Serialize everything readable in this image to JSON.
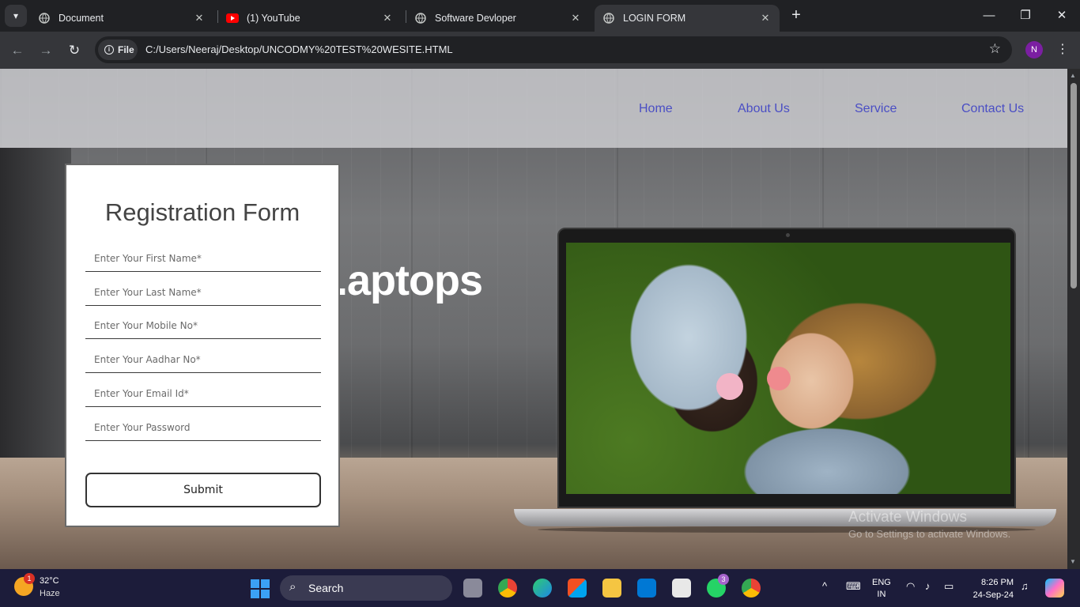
{
  "browser": {
    "tabs": [
      {
        "title": "Document",
        "favicon": "globe-icon",
        "active": false
      },
      {
        "title": "(1) YouTube",
        "favicon": "youtube-icon",
        "active": false
      },
      {
        "title": "Software Devloper",
        "favicon": "globe-icon",
        "active": false
      },
      {
        "title": "LOGIN FORM",
        "favicon": "globe-icon",
        "active": true
      }
    ],
    "address": {
      "chip": "File",
      "url": "C:/Users/Neeraj/Desktop/UNCODMY%20TEST%20WESITE.HTML"
    },
    "profile_initial": "N"
  },
  "site": {
    "nav": [
      "Home",
      "About Us",
      "Service",
      "Contact Us"
    ],
    "hero_text": ".aptops",
    "form": {
      "title": "Registration Form",
      "fields": [
        "Enter Your First Name*",
        "Enter Your Last Name*",
        "Enter Your Mobile No*",
        "Enter Your Aadhar No*",
        "Enter Your Email Id*",
        "Enter Your Password"
      ],
      "submit": "Submit"
    },
    "watermark": {
      "line1": "Activate Windows",
      "line2": "Go to Settings to activate Windows."
    }
  },
  "taskbar": {
    "weather": {
      "temp": "32°C",
      "condition": "Haze",
      "badge": "1"
    },
    "search_label": "Search",
    "whatsapp_badge": "3",
    "language": {
      "line1": "ENG",
      "line2": "IN"
    },
    "time": "8:26 PM",
    "date": "24-Sep-24"
  },
  "colors": {
    "nav_link": "#4a4ec4",
    "browser_bg": "#202124",
    "toolbar_bg": "#35363a",
    "taskbar_bg": "#1c1c3a"
  }
}
